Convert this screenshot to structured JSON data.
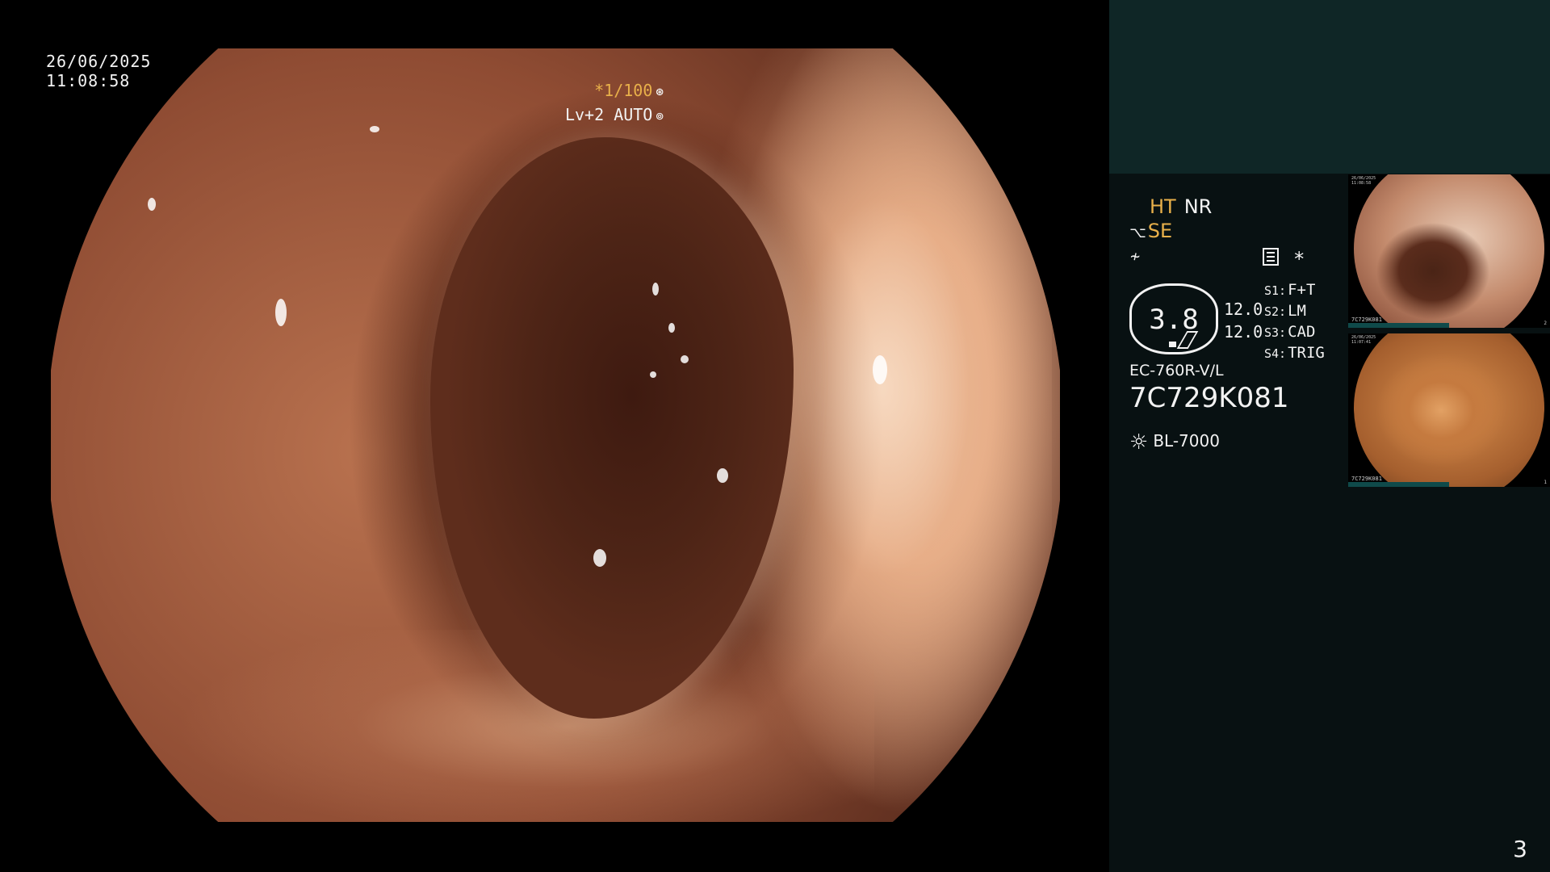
{
  "overlay": {
    "date": "26/06/2025",
    "time": "11:08:58",
    "shutter": "*1/100",
    "shutter_icon": "aperture-icon",
    "level": "Lv+2",
    "auto": "AUTO",
    "auto_icon": "iris-icon"
  },
  "panel": {
    "ht": "HT",
    "nr": "NR",
    "se": "SE",
    "star": "*",
    "gauge_value": "3.8",
    "gauge_upper": "12.0",
    "gauge_lower": "12.0",
    "settings": [
      {
        "key": "S1:",
        "value": "F+T"
      },
      {
        "key": "S2:",
        "value": "LM"
      },
      {
        "key": "S3:",
        "value": "CAD"
      },
      {
        "key": "S4:",
        "value": "TRIG"
      }
    ],
    "scope_model": "EC-760R-V/L",
    "scope_serial": "7C729K081",
    "light_source": "BL-7000"
  },
  "thumbnails": [
    {
      "date": "26/06/2025",
      "time": "11:08:58",
      "serial": "7C729K081",
      "number": "2"
    },
    {
      "date": "26/06/2025",
      "time": "11:07:41",
      "serial": "7C729K081",
      "number": "1"
    }
  ],
  "page_number": "3",
  "colors": {
    "accent": "#e8b04a",
    "sidebar_bg": "#081112",
    "sidebar_top_bg": "#0f2626"
  }
}
